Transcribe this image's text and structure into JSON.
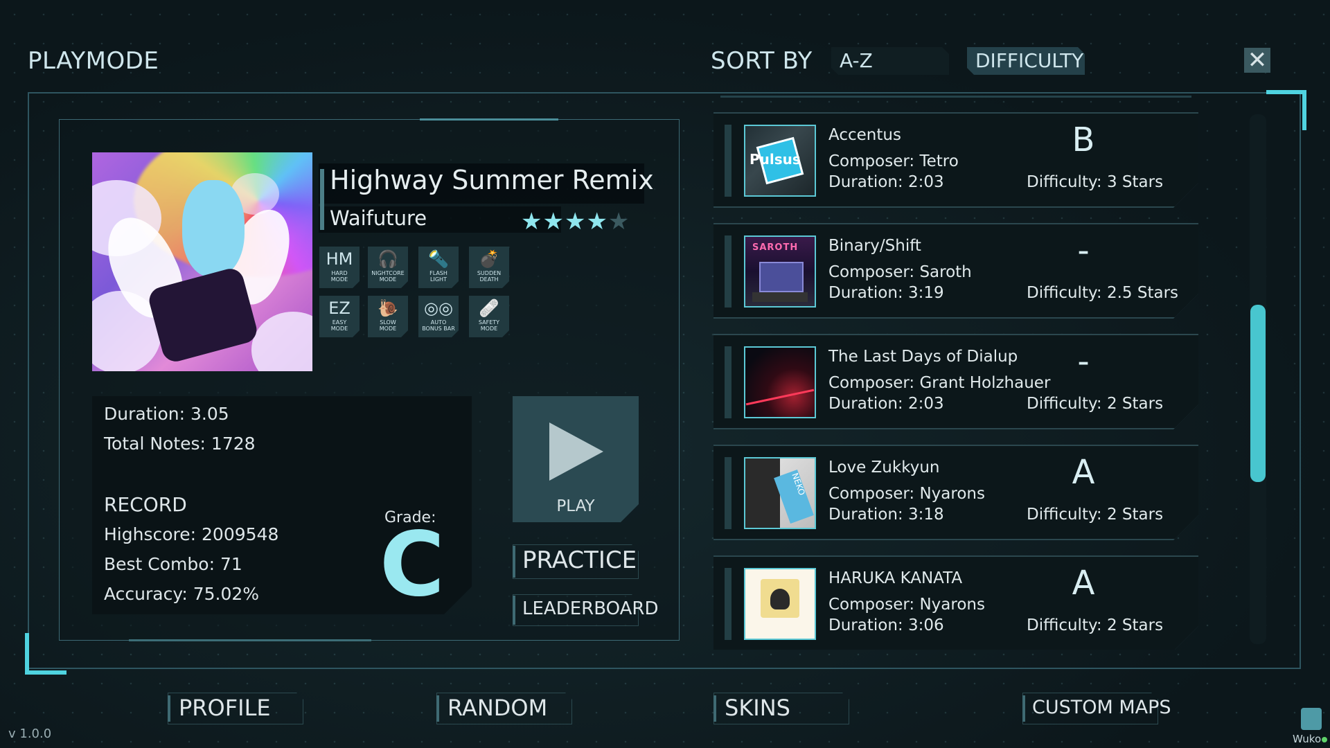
{
  "header": {
    "title": "PLAYMODE",
    "sort_label": "SORT BY",
    "sort_options": [
      "A-Z",
      "DIFFICULTY"
    ],
    "sort_selected": "DIFFICULTY"
  },
  "selected_song": {
    "title": "Highway Summer Remix",
    "artist": "Waifuture",
    "stars_filled": "★★★★",
    "stars_empty": "★",
    "rating_stars": 4,
    "rating_max": 5,
    "duration_label": "Duration:",
    "duration": "3.05",
    "notes_label": "Total Notes:",
    "notes": "1728",
    "record_label": "RECORD",
    "highscore_label": "Highscore:",
    "highscore": "2009548",
    "combo_label": "Best Combo:",
    "combo": "71",
    "accuracy_label": "Accuracy:",
    "accuracy": "75.02%",
    "grade_label": "Grade:",
    "grade": "C"
  },
  "mods": [
    {
      "icon": "HM",
      "label1": "HARD",
      "label2": "MODE",
      "icon_name": "hard-mode-icon"
    },
    {
      "icon": "🎧",
      "label1": "NIGHTCORE",
      "label2": "MODE",
      "icon_name": "headphones-icon"
    },
    {
      "icon": "🔦",
      "label1": "FLASH",
      "label2": "LIGHT",
      "icon_name": "flashlight-icon"
    },
    {
      "icon": "💣",
      "label1": "SUDDEN",
      "label2": "DEATH",
      "icon_name": "bomb-icon"
    },
    {
      "icon": "EZ",
      "label1": "EASY",
      "label2": "MODE",
      "icon_name": "easy-mode-icon"
    },
    {
      "icon": "🐌",
      "label1": "SLOW",
      "label2": "MODE",
      "icon_name": "snail-icon"
    },
    {
      "icon": "◎◎",
      "label1": "AUTO",
      "label2": "BONUS BAR",
      "icon_name": "auto-bonus-bar-icon"
    },
    {
      "icon": "🩹",
      "label1": "SAFETY",
      "label2": "MODE",
      "icon_name": "bandage-icon"
    }
  ],
  "actions": {
    "play": "PLAY",
    "practice": "PRACTICE",
    "leaderboard": "LEADERBOARD"
  },
  "song_list": [
    {
      "title": "Accentus",
      "composer": "Composer: Tetro",
      "duration": "Duration: 2:03",
      "difficulty": "Difficulty: 3 Stars",
      "grade": "B",
      "thumb_text": "Pulsus"
    },
    {
      "title": "Binary/Shift",
      "composer": "Composer: Saroth",
      "duration": "Duration: 3:19",
      "difficulty": "Difficulty: 2.5 Stars",
      "grade": "-",
      "thumb_text": "SAROTH"
    },
    {
      "title": "The Last Days of Dialup",
      "composer": "Composer: Grant Holzhauer",
      "duration": "Duration: 2:03",
      "difficulty": "Difficulty: 2 Stars",
      "grade": "-",
      "thumb_text": ""
    },
    {
      "title": "Love Zukkyun",
      "composer": "Composer: Nyarons",
      "duration": "Duration: 3:18",
      "difficulty": "Difficulty: 2 Stars",
      "grade": "A",
      "thumb_text": "NEKO"
    },
    {
      "title": "HARUKA KANATA",
      "composer": "Composer: Nyarons",
      "duration": "Duration: 3:06",
      "difficulty": "Difficulty: 2 Stars",
      "grade": "A",
      "thumb_text": ""
    }
  ],
  "bottom_nav": [
    "PROFILE",
    "RANDOM",
    "SKINS",
    "CUSTOM MAPS"
  ],
  "footer": {
    "version": "v 1.0.0",
    "username": "Wuko"
  },
  "colors": {
    "accent": "#4fd3e0",
    "background": "#0e1a1e",
    "panel": "#0c171a",
    "grade_text": "#9ae8f0"
  }
}
